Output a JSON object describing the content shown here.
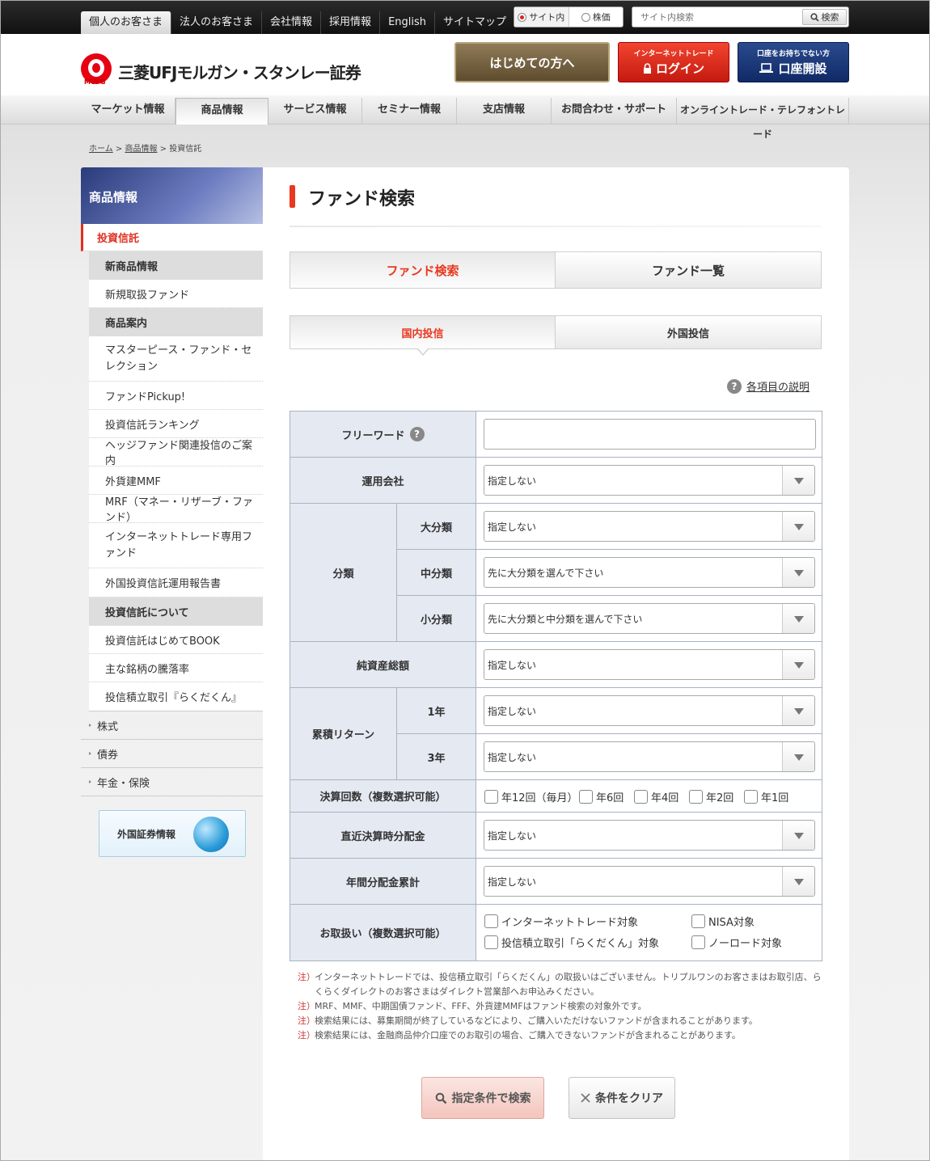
{
  "topnav": [
    "個人のお客さま",
    "法人のお客さま",
    "会社情報",
    "採用情報",
    "English",
    "サイトマップ"
  ],
  "search": {
    "opt_site": "サイト内",
    "opt_stock": "株価",
    "placeholder": "サイト内検索",
    "button": "検索"
  },
  "logo": {
    "name": "三菱UFJモルガン・スタンレー証券",
    "mark": "MUFG"
  },
  "header_buttons": {
    "first": "はじめての方へ",
    "login_sub": "インターネットトレード",
    "login": "ログイン",
    "open_sub": "口座をお持ちでない方",
    "open": "口座開設"
  },
  "mainnav": [
    "マーケット情報",
    "商品情報",
    "サービス情報",
    "セミナー情報",
    "支店情報",
    "お問合わせ・サポート",
    "オンライントレード・テレフォントレード"
  ],
  "breadcrumb": {
    "home": "ホーム",
    "product": "商品情報",
    "current": "投資信託"
  },
  "sidebar": {
    "title": "商品情報",
    "current": "投資信託",
    "group1": "新商品情報",
    "group1_items": [
      "新規取扱ファンド"
    ],
    "group2": "商品案内",
    "group2_items": [
      "マスターピース・ファンド・セレクション",
      "ファンドPickup!",
      "投資信託ランキング",
      "ヘッジファンド関連投信のご案内",
      "外貨建MMF",
      "MRF（マネー・リザーブ・ファンド）",
      "インターネットトレード専用ファンド",
      "外国投資信託運用報告書"
    ],
    "group3": "投資信託について",
    "group3_items": [
      "投資信託はじめてBOOK",
      "主な銘柄の騰落率",
      "投信積立取引『らくだくん』"
    ],
    "other": [
      "株式",
      "債券",
      "年金・保険"
    ],
    "foreign": "外国証券情報"
  },
  "page": {
    "title": "ファンド検索",
    "tab_search": "ファンド検索",
    "tab_list": "ファンド一覧",
    "subtab_domestic": "国内投信",
    "subtab_foreign": "外国投信",
    "help": "各項目の説明"
  },
  "form": {
    "freeword": "フリーワード",
    "company": "運用会社",
    "company_value": "指定しない",
    "class": "分類",
    "class_large": "大分類",
    "class_large_value": "指定しない",
    "class_mid": "中分類",
    "class_mid_value": "先に大分類を選んで下さい",
    "class_small": "小分類",
    "class_small_value": "先に大分類と中分類を選んで下さい",
    "assets": "純資産総額",
    "assets_value": "指定しない",
    "return": "累積リターン",
    "return_1y": "1年",
    "return_1y_value": "指定しない",
    "return_3y": "3年",
    "return_3y_value": "指定しない",
    "settle": "決算回数（複数選択可能）",
    "settle_opts": [
      "年12回（毎月）",
      "年6回",
      "年4回",
      "年2回",
      "年1回"
    ],
    "recent_div": "直近決算時分配金",
    "recent_div_value": "指定しない",
    "annual_div": "年間分配金累計",
    "annual_div_value": "指定しない",
    "handling": "お取扱い（複数選択可能）",
    "handling_opts": [
      "インターネットトレード対象",
      "NISA対象",
      "投信積立取引「らくだくん」対象",
      "ノーロード対象"
    ]
  },
  "notes": {
    "mark": "注）",
    "items": [
      "インターネットトレードでは、投信積立取引「らくだくん」の取扱いはございません。トリプルワンのお客さまはお取引店、らくらくダイレクトのお客さまはダイレクト営業部へお申込みください。",
      "MRF、MMF、中期国債ファンド、FFF、外貨建MMFはファンド検索の対象外です。",
      "検索結果には、募集期間が終了しているなどにより、ご購入いただけないファンドが含まれることがあります。",
      "検索結果には、金融商品仲介口座でのお取引の場合、ご購入できないファンドが含まれることがあります。"
    ]
  },
  "buttons": {
    "search": "指定条件で検索",
    "clear": "条件をクリア"
  }
}
